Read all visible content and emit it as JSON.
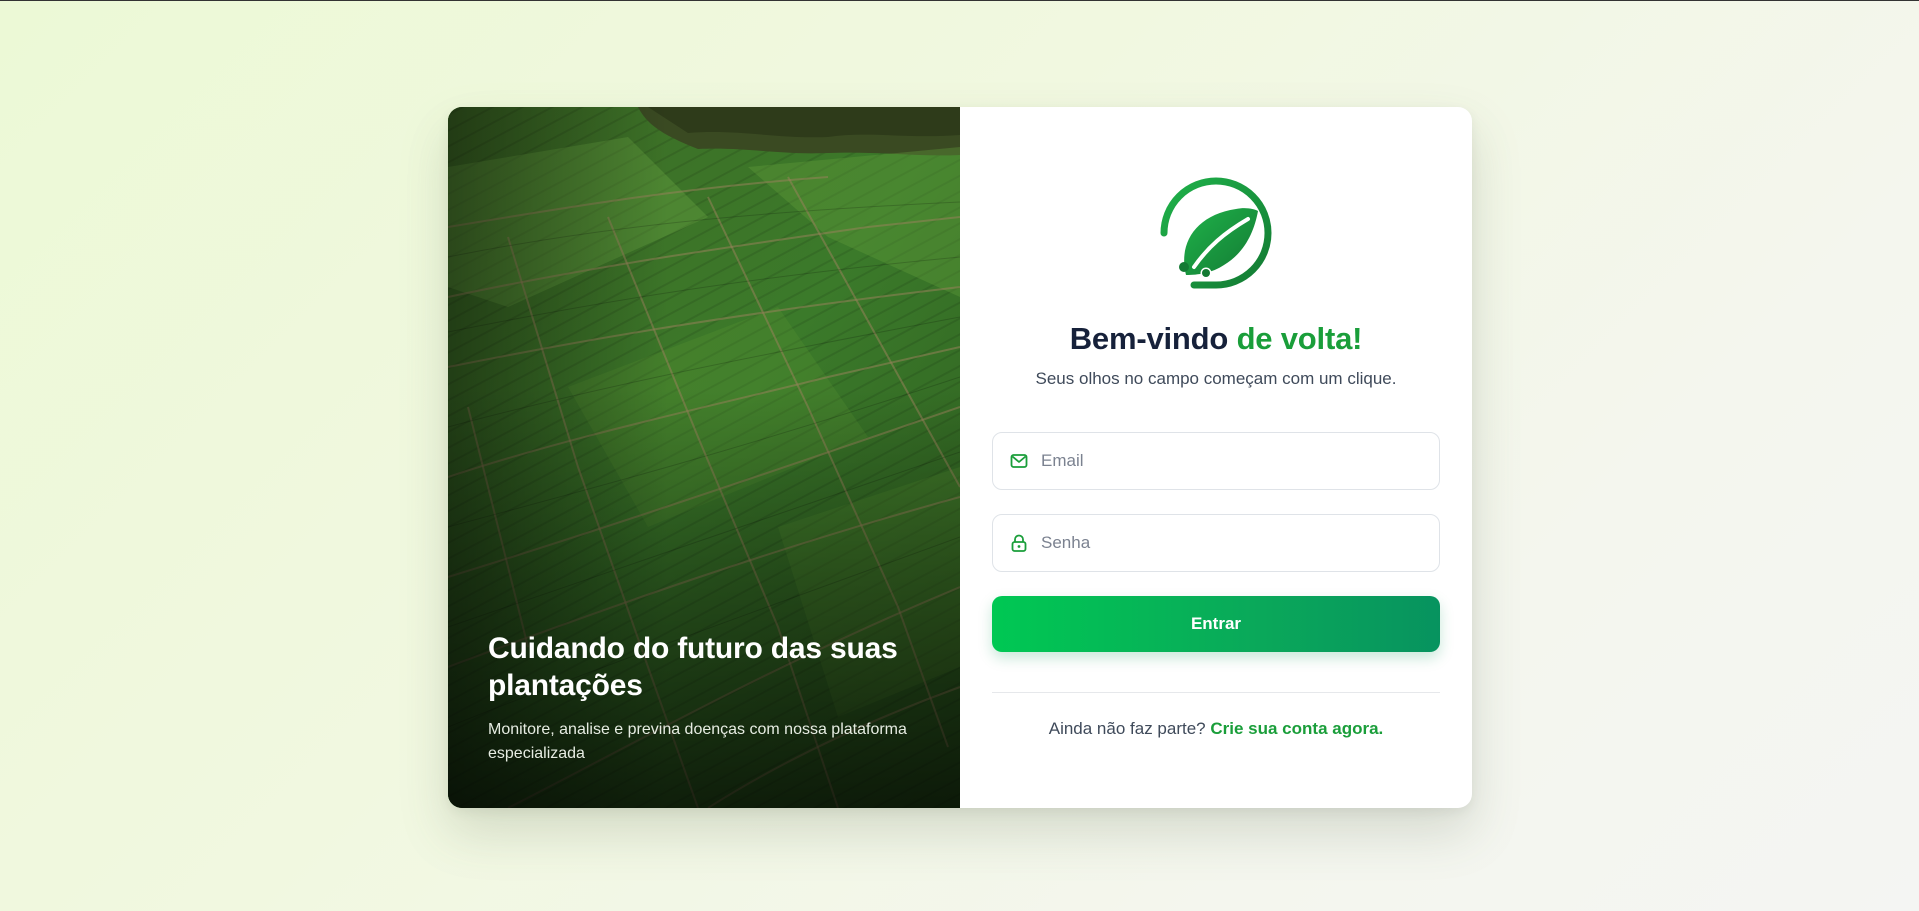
{
  "hero": {
    "title": "Cuidando do futuro das suas plantações",
    "subtitle": "Monitore, analise e previna doenças com nossa plataforma especializada"
  },
  "login": {
    "logo_icon": "leaf-logo-icon",
    "heading_main": "Bem-vindo",
    "heading_accent": "de volta!",
    "subheading": "Seus olhos no campo começam com um clique.",
    "email": {
      "placeholder": "Email",
      "value": "",
      "icon": "mail-icon"
    },
    "password": {
      "placeholder": "Senha",
      "value": "",
      "icon": "lock-icon"
    },
    "submit_label": "Entrar",
    "signup_prompt": "Ainda não faz parte?",
    "signup_link": "Crie sua conta agora."
  },
  "colors": {
    "brand_green": "#1a9e3a",
    "button_gradient_start": "#00c853",
    "button_gradient_end": "#07935f",
    "heading_dark": "#16213a"
  }
}
